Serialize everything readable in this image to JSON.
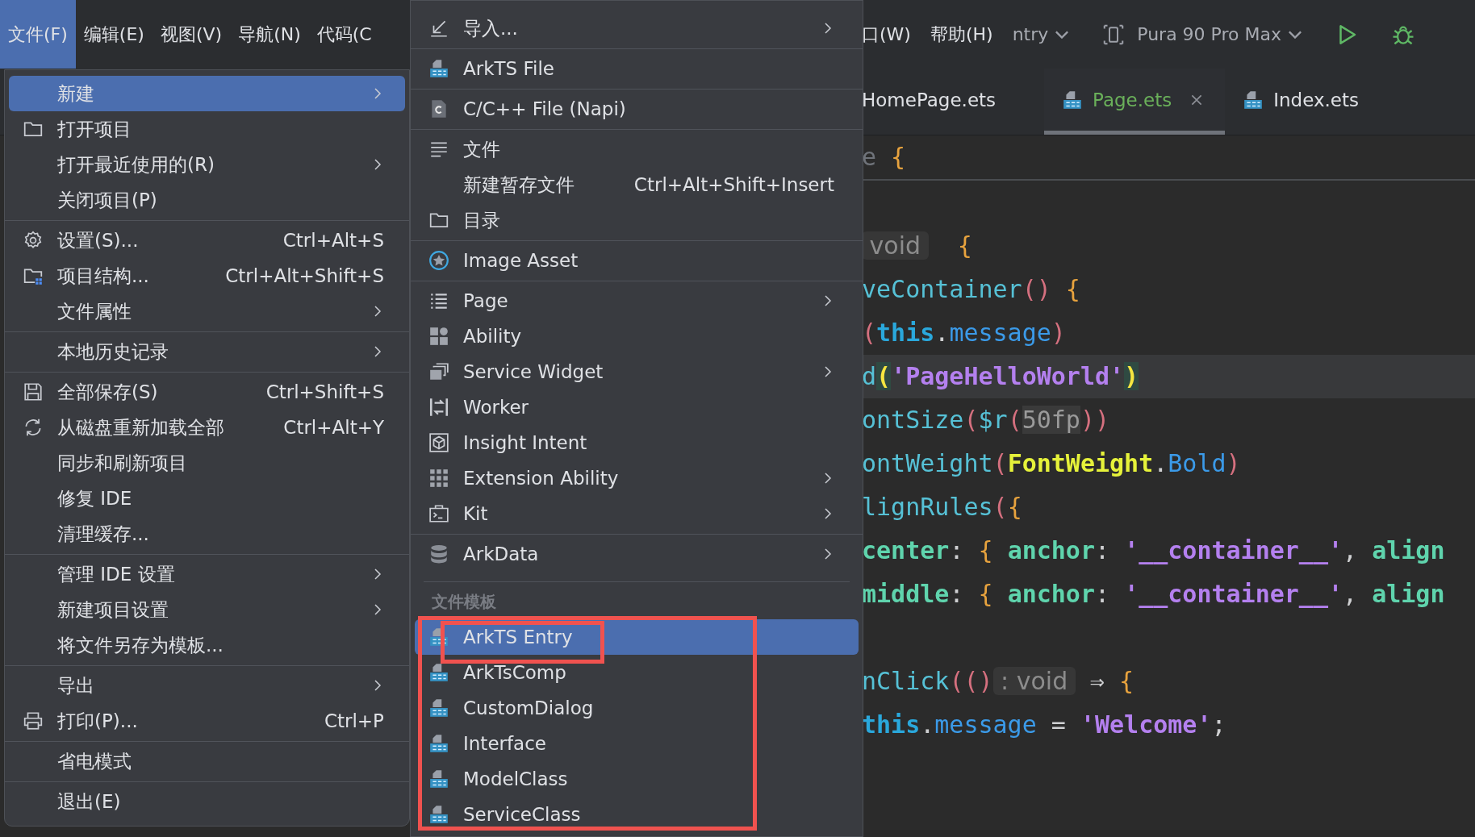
{
  "menu_bar": {
    "items": [
      {
        "label": "文件(F)",
        "selected": true
      },
      {
        "label": "编辑(E)",
        "selected": false
      },
      {
        "label": "视图(V)",
        "selected": false
      },
      {
        "label": "导航(N)",
        "selected": false
      },
      {
        "label": "代码(C",
        "selected": false
      }
    ],
    "right_items": [
      {
        "label": "口(W)"
      },
      {
        "label": "帮助(H)"
      }
    ],
    "run_config": "ntry",
    "device": "Pura 90 Pro Max"
  },
  "editor_tabs": [
    {
      "label": "HomePage.ets",
      "selected": false
    },
    {
      "label": "Page.ets",
      "selected": true
    },
    {
      "label": "Index.ets",
      "selected": false
    }
  ],
  "code": {
    "lines": [
      {
        "kind": "sticky",
        "current": false,
        "tokens": [
          {
            "t": "e",
            "kind": "dim"
          },
          {
            "t": " {",
            "kind": "brace"
          }
        ]
      },
      {
        "kind": "blank",
        "current": false
      },
      {
        "kind": "code",
        "current": false,
        "tokens": [
          {
            "t": " void ",
            "kind": "hint"
          },
          {
            "t": "  {",
            "kind": "brace"
          }
        ]
      },
      {
        "kind": "code",
        "current": false,
        "tokens": [
          {
            "t": "veContainer",
            "kind": "fn"
          },
          {
            "t": "()",
            "kind": "paren"
          },
          {
            "t": " {",
            "kind": "brace"
          }
        ]
      },
      {
        "kind": "code",
        "current": false,
        "tokens": [
          {
            "t": "(",
            "kind": "paren"
          },
          {
            "t": "this",
            "kind": "kw"
          },
          {
            "t": ".",
            "kind": "punct"
          },
          {
            "t": "message",
            "kind": "prop"
          },
          {
            "t": ")",
            "kind": "paren"
          }
        ]
      },
      {
        "kind": "code",
        "current": true,
        "tokens": [
          {
            "t": "d",
            "kind": "fn"
          },
          {
            "t": "(",
            "kind": "match"
          },
          {
            "t": "'PageHelloWorld'",
            "kind": "str"
          },
          {
            "t": ")",
            "kind": "match"
          }
        ]
      },
      {
        "kind": "code",
        "current": false,
        "tokens": [
          {
            "t": "ontSize",
            "kind": "fn"
          },
          {
            "t": "(",
            "kind": "paren"
          },
          {
            "t": "$r",
            "kind": "fn"
          },
          {
            "t": "(",
            "kind": "paren"
          },
          {
            "t": "50fp",
            "kind": "num"
          },
          {
            "t": "))",
            "kind": "paren"
          }
        ]
      },
      {
        "kind": "code",
        "current": false,
        "tokens": [
          {
            "t": "ontWeight",
            "kind": "fn"
          },
          {
            "t": "(",
            "kind": "paren"
          },
          {
            "t": "FontWeight",
            "kind": "cls"
          },
          {
            "t": ".",
            "kind": "punct"
          },
          {
            "t": "Bold",
            "kind": "prop"
          },
          {
            "t": ")",
            "kind": "paren"
          }
        ]
      },
      {
        "kind": "code",
        "current": false,
        "tokens": [
          {
            "t": "lignRules",
            "kind": "fn"
          },
          {
            "t": "(",
            "kind": "paren"
          },
          {
            "t": "{",
            "kind": "brace"
          }
        ]
      },
      {
        "kind": "code",
        "current": false,
        "tokens": [
          {
            "t": "center",
            "kind": "key"
          },
          {
            "t": ": ",
            "kind": "punct"
          },
          {
            "t": "{ ",
            "kind": "brace"
          },
          {
            "t": "anchor",
            "kind": "key"
          },
          {
            "t": ": ",
            "kind": "punct"
          },
          {
            "t": "'__container__'",
            "kind": "str"
          },
          {
            "t": ", ",
            "kind": "punct"
          },
          {
            "t": "align",
            "kind": "key"
          }
        ]
      },
      {
        "kind": "code",
        "current": false,
        "tokens": [
          {
            "t": "middle",
            "kind": "key"
          },
          {
            "t": ": ",
            "kind": "punct"
          },
          {
            "t": "{ ",
            "kind": "brace"
          },
          {
            "t": "anchor",
            "kind": "key"
          },
          {
            "t": ": ",
            "kind": "punct"
          },
          {
            "t": "'__container__'",
            "kind": "str"
          },
          {
            "t": ", ",
            "kind": "punct"
          },
          {
            "t": "align",
            "kind": "key"
          }
        ]
      },
      {
        "kind": "blank",
        "current": false
      },
      {
        "kind": "code",
        "current": false,
        "tokens": [
          {
            "t": "nClick",
            "kind": "fn"
          },
          {
            "t": "(()",
            "kind": "paren"
          },
          {
            "t": " : void ",
            "kind": "hint"
          },
          {
            "t": " ⇒ ",
            "kind": "punct"
          },
          {
            "t": "{",
            "kind": "brace"
          }
        ]
      },
      {
        "kind": "code",
        "current": false,
        "tokens": [
          {
            "t": "this",
            "kind": "kw"
          },
          {
            "t": ".",
            "kind": "punct"
          },
          {
            "t": "message",
            "kind": "prop"
          },
          {
            "t": " = ",
            "kind": "punct"
          },
          {
            "t": "'Welcome'",
            "kind": "str"
          },
          {
            "t": ";",
            "kind": "punct"
          }
        ]
      }
    ]
  },
  "file_menu": {
    "sections": [
      {
        "items": [
          {
            "label": "新建",
            "has_submenu": true,
            "selected": true
          },
          {
            "label": "打开项目",
            "has_submenu": false,
            "selected": false
          },
          {
            "label": "打开最近使用的(R)",
            "has_submenu": true,
            "selected": false
          },
          {
            "label": "关闭项目(P)",
            "has_submenu": false,
            "selected": false
          }
        ]
      },
      {
        "items": [
          {
            "label": "设置(S)...",
            "shortcut": "Ctrl+Alt+S",
            "has_submenu": false,
            "selected": false
          },
          {
            "label": "项目结构...",
            "shortcut": "Ctrl+Alt+Shift+S",
            "has_submenu": false,
            "selected": false
          },
          {
            "label": "文件属性",
            "has_submenu": true,
            "selected": false
          }
        ]
      },
      {
        "items": [
          {
            "label": "本地历史记录",
            "has_submenu": true,
            "selected": false
          }
        ]
      },
      {
        "items": [
          {
            "label": "全部保存(S)",
            "shortcut": "Ctrl+Shift+S",
            "has_submenu": false,
            "selected": false
          },
          {
            "label": "从磁盘重新加载全部",
            "shortcut": "Ctrl+Alt+Y",
            "has_submenu": false,
            "selected": false
          },
          {
            "label": "同步和刷新项目",
            "has_submenu": false,
            "selected": false
          },
          {
            "label": "修复 IDE",
            "has_submenu": false,
            "selected": false
          },
          {
            "label": "清理缓存...",
            "has_submenu": false,
            "selected": false
          }
        ]
      },
      {
        "items": [
          {
            "label": "管理 IDE 设置",
            "has_submenu": true,
            "selected": false
          },
          {
            "label": "新建项目设置",
            "has_submenu": true,
            "selected": false
          },
          {
            "label": "将文件另存为模板...",
            "has_submenu": false,
            "selected": false
          }
        ]
      },
      {
        "items": [
          {
            "label": "导出",
            "has_submenu": true,
            "selected": false
          },
          {
            "label": "打印(P)...",
            "shortcut": "Ctrl+P",
            "has_submenu": false,
            "selected": false
          }
        ]
      },
      {
        "items": [
          {
            "label": "省电模式",
            "has_submenu": false,
            "selected": false
          }
        ]
      },
      {
        "items": [
          {
            "label": "退出(E)",
            "has_submenu": false,
            "selected": false
          }
        ]
      }
    ]
  },
  "new_submenu": {
    "sections": [
      {
        "items": [
          {
            "label": "导入...",
            "has_submenu": true,
            "selected": false
          }
        ]
      },
      {
        "items": [
          {
            "label": "ArkTS File",
            "has_submenu": false,
            "selected": false
          }
        ]
      },
      {
        "items": [
          {
            "label": "C/C++ File (Napi)",
            "has_submenu": false,
            "selected": false
          }
        ]
      },
      {
        "items": [
          {
            "label": "文件",
            "has_submenu": false,
            "selected": false
          },
          {
            "label": "新建暂存文件",
            "shortcut": "Ctrl+Alt+Shift+Insert",
            "has_submenu": false,
            "selected": false
          },
          {
            "label": "目录",
            "has_submenu": false,
            "selected": false
          }
        ]
      },
      {
        "items": [
          {
            "label": "Image Asset",
            "has_submenu": false,
            "selected": false
          }
        ]
      },
      {
        "items": [
          {
            "label": "Page",
            "has_submenu": true,
            "selected": false
          },
          {
            "label": "Ability",
            "has_submenu": false,
            "selected": false
          },
          {
            "label": "Service Widget",
            "has_submenu": true,
            "selected": false
          },
          {
            "label": "Worker",
            "has_submenu": false,
            "selected": false
          },
          {
            "label": "Insight Intent",
            "has_submenu": false,
            "selected": false
          },
          {
            "label": "Extension Ability",
            "has_submenu": true,
            "selected": false
          },
          {
            "label": "Kit",
            "has_submenu": true,
            "selected": false
          }
        ]
      },
      {
        "items": [
          {
            "label": "ArkData",
            "has_submenu": true,
            "selected": false
          }
        ]
      }
    ],
    "template_header": "文件模板",
    "templates": [
      {
        "label": "ArkTS Entry",
        "selected": true
      },
      {
        "label": "ArkTsComp",
        "selected": false
      },
      {
        "label": "CustomDialog",
        "selected": false
      },
      {
        "label": "Interface",
        "selected": false
      },
      {
        "label": "ModelClass",
        "selected": false
      },
      {
        "label": "ServiceClass",
        "selected": false
      }
    ]
  }
}
